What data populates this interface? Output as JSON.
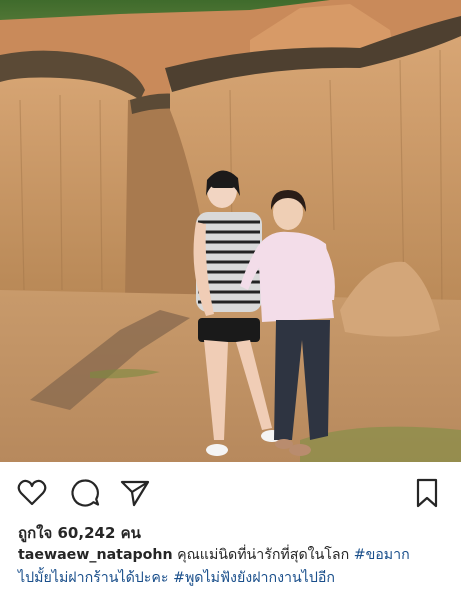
{
  "post": {
    "image_alt": "Two women posing among tall eroded sandstone earth pillars",
    "actions": {
      "like_icon": "heart-outline-icon",
      "comment_icon": "comment-bubble-icon",
      "share_icon": "paper-plane-icon",
      "save_icon": "bookmark-outline-icon"
    },
    "likes_text": "ถูกใจ 60,242 คน",
    "caption": {
      "username": "taewaew_natapohn",
      "text_1": "คุณแม่นิดที่น่ารักที่สุดในโลก",
      "hashtag_1": "#ขอมาก",
      "text_2": "ไปมั้ยไม่ฝากร้านได้ปะคะ",
      "hashtag_2": "#พูดไม่ฟังยังฝากงานไปอีก"
    }
  },
  "colors": {
    "text": "#262626",
    "hashtag": "#1a4f8b",
    "background": "#ffffff"
  }
}
